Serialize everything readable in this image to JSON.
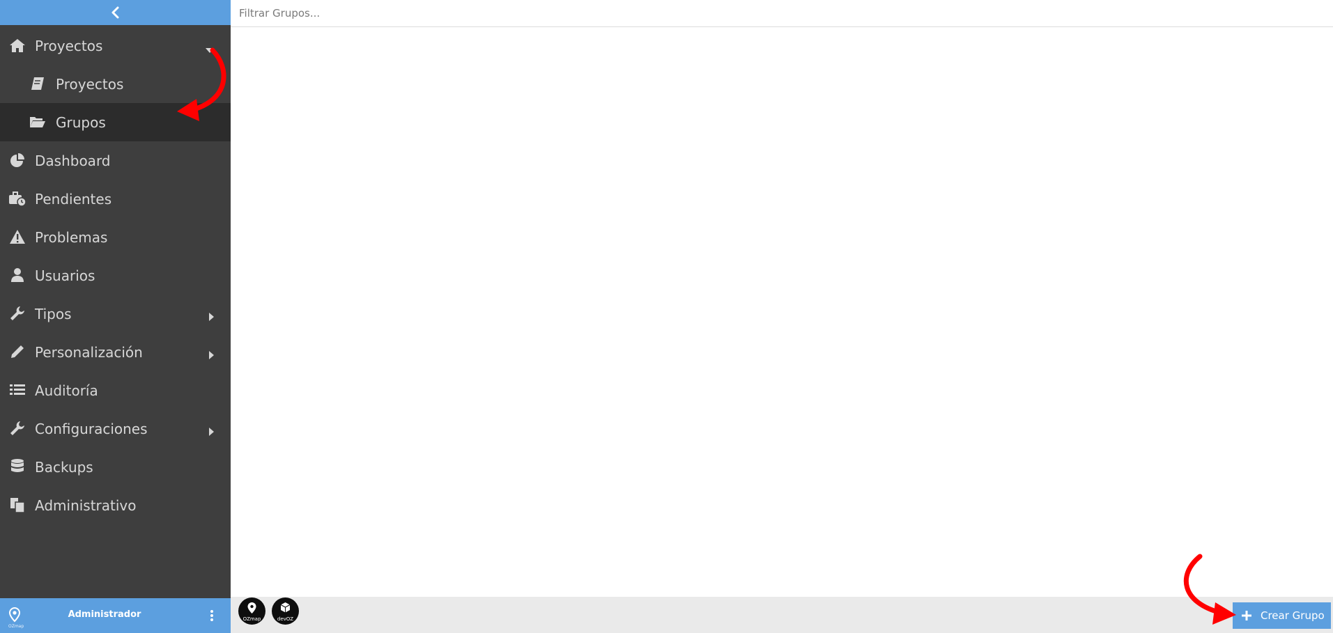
{
  "sidebar": {
    "collapse_icon": "chevron-left-icon",
    "items": [
      {
        "label": "Proyectos",
        "icon": "home-icon",
        "caret": "down"
      },
      {
        "label": "Proyectos",
        "icon": "book-icon",
        "sub": true
      },
      {
        "label": "Grupos",
        "icon": "folder-open-icon",
        "sub": true,
        "active": true
      },
      {
        "label": "Dashboard",
        "icon": "pie-chart-icon"
      },
      {
        "label": "Pendientes",
        "icon": "briefcase-clock-icon"
      },
      {
        "label": "Problemas",
        "icon": "warning-icon"
      },
      {
        "label": "Usuarios",
        "icon": "user-icon"
      },
      {
        "label": "Tipos",
        "icon": "wrench-icon",
        "caret": "right"
      },
      {
        "label": "Personalización",
        "icon": "pencil-icon",
        "caret": "right"
      },
      {
        "label": "Auditoría",
        "icon": "list-icon"
      },
      {
        "label": "Configuraciones",
        "icon": "wrench-icon",
        "caret": "right"
      },
      {
        "label": "Backups",
        "icon": "database-icon"
      },
      {
        "label": "Administrativo",
        "icon": "documents-icon"
      }
    ],
    "user": {
      "logo_text": "OZmap",
      "name": "Administrador"
    }
  },
  "filter": {
    "placeholder": "Filtrar Grupos..."
  },
  "footer": {
    "apps": [
      {
        "name": "OZmap",
        "icon": "ozmap-app-icon"
      },
      {
        "name": "devOZ",
        "icon": "devoz-app-icon"
      }
    ],
    "create_button": {
      "label": "Crear Grupo",
      "icon": "plus-icon"
    }
  },
  "colors": {
    "accent": "#5c9fdf",
    "sidebar_bg": "#3e3e3e",
    "sidebar_active": "#2c2c2c",
    "annotation": "#ff0000"
  }
}
